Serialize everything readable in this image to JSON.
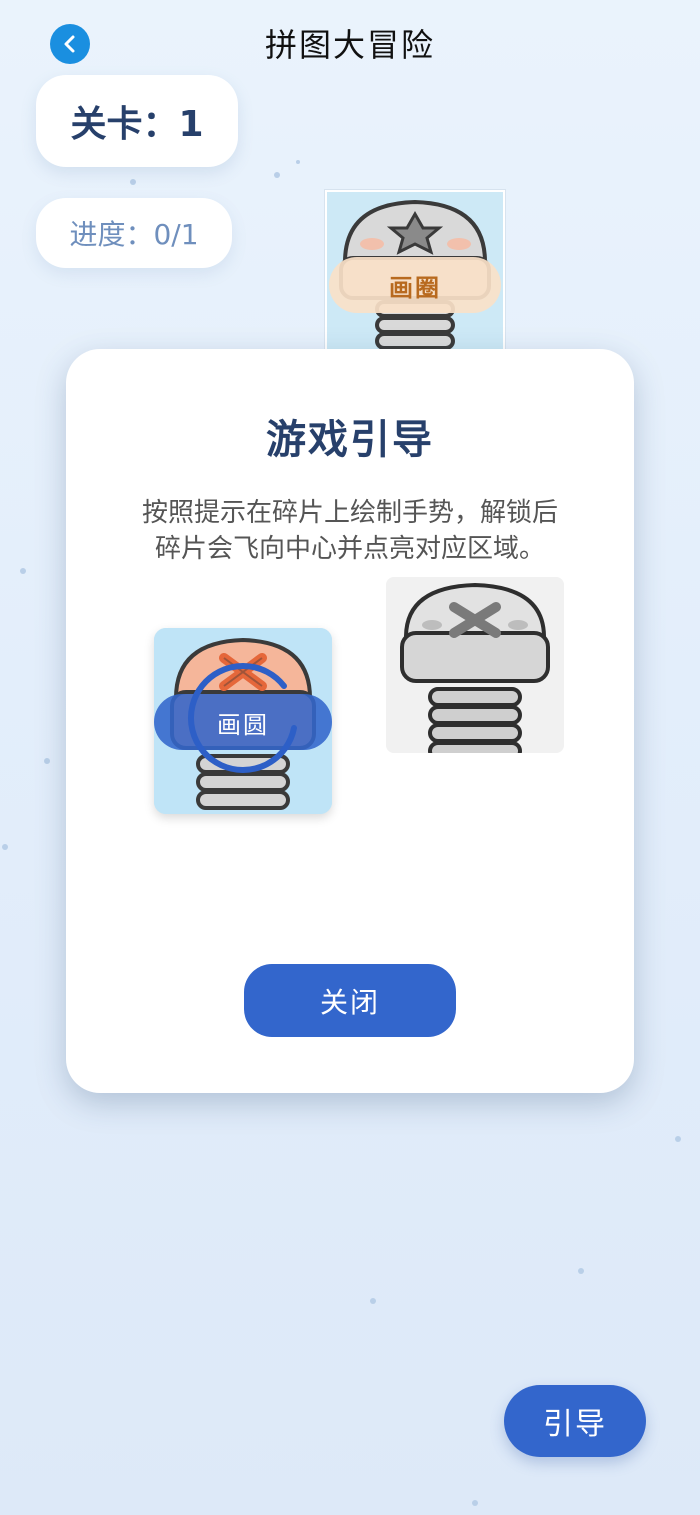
{
  "header": {
    "title": "拼图大冒险",
    "back_icon": "chevron-left-icon"
  },
  "status": {
    "level": "关卡：1",
    "progress": "进度：0/1"
  },
  "puzzle_piece": {
    "gesture_label": "画圈",
    "image": "screw-icon"
  },
  "guide_modal": {
    "title": "游戏引导",
    "description_line1": "按照提示在碎片上绘制手势，解锁后",
    "description_line2": "碎片会飞向中心并点亮对应区域。",
    "demo_gesture_label": "画圆",
    "close_label": "关闭"
  },
  "guide_button": {
    "label": "引导"
  },
  "colors": {
    "primary": "#3366cc",
    "title_text": "#27406b",
    "back_button": "#1a8fe0"
  }
}
